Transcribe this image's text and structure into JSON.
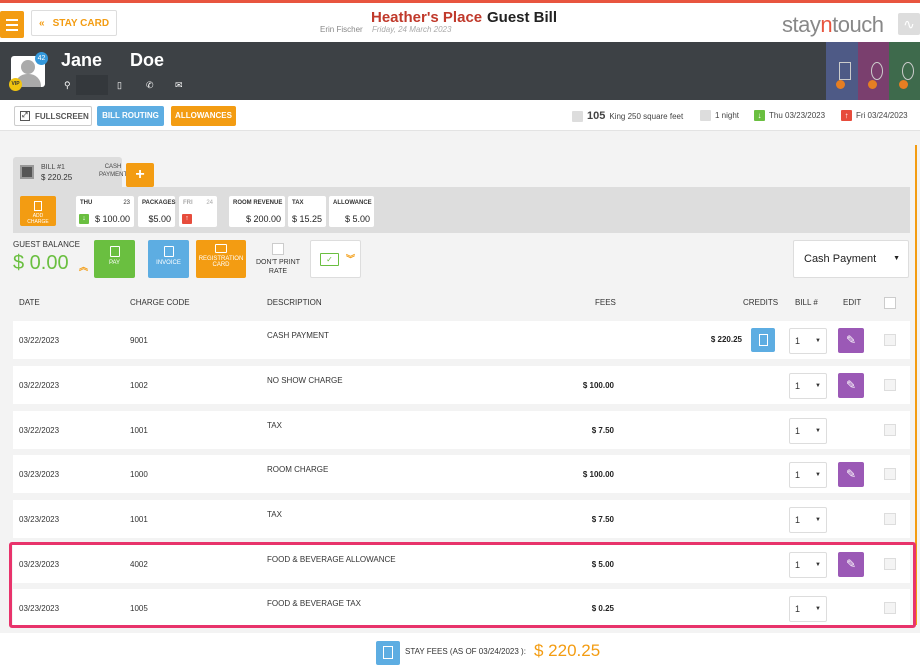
{
  "header": {
    "stay_card_label": "STAY CARD",
    "hotel_name": "Heather's Place",
    "page_title": "Guest Bill",
    "user_name": "Erin Fischer",
    "date": "Friday, 24 March 2023",
    "logo_pre": "stay",
    "logo_n": "n",
    "logo_post": "touch"
  },
  "guest": {
    "first_name": "Jane",
    "last_name": "Doe",
    "vip_label": "VIP",
    "badge_count": "42"
  },
  "actions": {
    "fullscreen": "FULLSCREEN",
    "bill_routing": "BILL ROUTING",
    "allowances": "ALLOWANCES"
  },
  "reservation": {
    "room_number": "105",
    "room_type": "King 250 square feet",
    "nights": "1 night",
    "arrival": "Thu 03/23/2023",
    "departure": "Fri 03/24/2023"
  },
  "bill_tab": {
    "bill_label": "BILL #1",
    "amount": "$ 220.25",
    "payment_line1": "CASH",
    "payment_line2": "PAYMENT",
    "add_label": "+"
  },
  "summary": {
    "add_charge_line1": "ADD",
    "add_charge_line2": "CHARGE",
    "days": [
      {
        "day": "THU",
        "num": "23",
        "amount": "$ 100.00"
      },
      {
        "day": "FRI",
        "num": "24",
        "amount": ""
      }
    ],
    "packages_label": "PACKAGES",
    "packages_value": "$5.00",
    "room_revenue_label": "ROOM REVENUE",
    "room_revenue_value": "$ 200.00",
    "tax_label": "TAX",
    "tax_value": "$ 15.25",
    "allowance_label": "ALLOWANCE",
    "allowance_value": "$ 5.00"
  },
  "balance": {
    "label": "GUEST BALANCE",
    "value": "$ 0.00",
    "pay_label": "PAY",
    "invoice_label": "INVOICE",
    "reg_card_line1": "REGISTRATION",
    "reg_card_line2": "CARD",
    "dont_print_line1": "DON'T PRINT",
    "dont_print_line2": "RATE",
    "payment_method": "Cash Payment"
  },
  "table": {
    "headers": {
      "date": "DATE",
      "charge_code": "CHARGE CODE",
      "description": "DESCRIPTION",
      "fees": "FEES",
      "credits": "CREDITS",
      "bill_no": "BILL #",
      "edit": "EDIT"
    },
    "rows": [
      {
        "date": "03/22/2023",
        "code": "9001",
        "description": "CASH PAYMENT",
        "fees": "",
        "credits": "$ 220.25",
        "bill": "1"
      },
      {
        "date": "03/22/2023",
        "code": "1002",
        "description": "NO SHOW CHARGE",
        "fees": "$ 100.00",
        "credits": "",
        "bill": "1"
      },
      {
        "date": "03/22/2023",
        "code": "1001",
        "description": "TAX",
        "fees": "$ 7.50",
        "credits": "",
        "bill": "1"
      },
      {
        "date": "03/23/2023",
        "code": "1000",
        "description": "ROOM CHARGE",
        "fees": "$ 100.00",
        "credits": "",
        "bill": "1"
      },
      {
        "date": "03/23/2023",
        "code": "1001",
        "description": "TAX",
        "fees": "$ 7.50",
        "credits": "",
        "bill": "1"
      },
      {
        "date": "03/23/2023",
        "code": "4002",
        "description": "FOOD & BEVERAGE ALLOWANCE",
        "fees": "$ 5.00",
        "credits": "",
        "bill": "1"
      },
      {
        "date": "03/23/2023",
        "code": "1005",
        "description": "FOOD & BEVERAGE TAX",
        "fees": "$ 0.25",
        "credits": "",
        "bill": "1"
      }
    ]
  },
  "footer": {
    "label": "STAY FEES (AS OF  03/24/2023 ):",
    "total": "$ 220.25"
  },
  "colors": {
    "accent": "#f39c12",
    "hotel": "#c0392b",
    "balance": "#6abf40",
    "edit": "#9b59b6",
    "info": "#5dade2",
    "highlight": "#e8336b"
  }
}
